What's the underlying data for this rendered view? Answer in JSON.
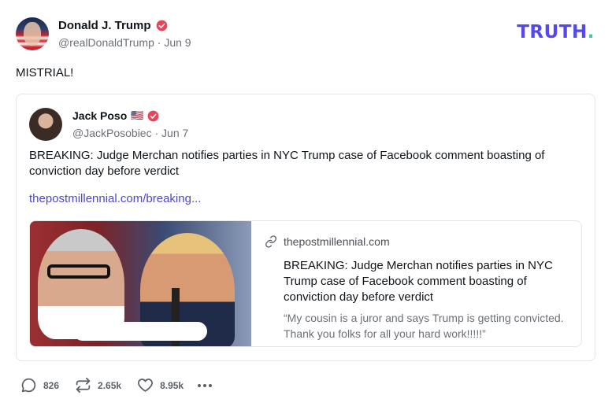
{
  "post": {
    "author": {
      "display_name": "Donald J. Trump",
      "handle": "@realDonaldTrump",
      "separator": "·",
      "date": "Jun 9"
    },
    "text": "MISTRIAL!"
  },
  "brand": {
    "logo_main": "TRUTH",
    "logo_dot": ".",
    "primary_color": "#5448ee",
    "accent_color": "#40c4aa"
  },
  "quote": {
    "author": {
      "display_name": "Jack Poso",
      "flag": "🇺🇸",
      "handle": "@JackPosobiec",
      "separator": "·",
      "date": "Jun 7"
    },
    "text": "BREAKING: Judge Merchan notifies parties in NYC Trump case of Facebook comment boasting of conviction day before verdict",
    "link_text": "thepostmillennial.com/breaking...",
    "preview": {
      "domain": "thepostmillennial.com",
      "title": "BREAKING: Judge Merchan notifies parties in NYC Trump case of Facebook comment boasting of conviction day before verdict",
      "description": "“My cousin is a juror and says Trump is getting convicted. Thank you folks for all your hard work!!!!!”"
    }
  },
  "actions": {
    "replies": "826",
    "retruths": "2.65k",
    "likes": "8.95k"
  },
  "icons": {
    "verified": "verified-badge-icon",
    "link": "link-icon",
    "reply": "reply-icon",
    "retruth": "retruth-icon",
    "like": "heart-icon",
    "more": "more-icon"
  },
  "colors": {
    "verified": "#e9445a",
    "link": "#4f46c8",
    "muted": "#6b6f76"
  }
}
